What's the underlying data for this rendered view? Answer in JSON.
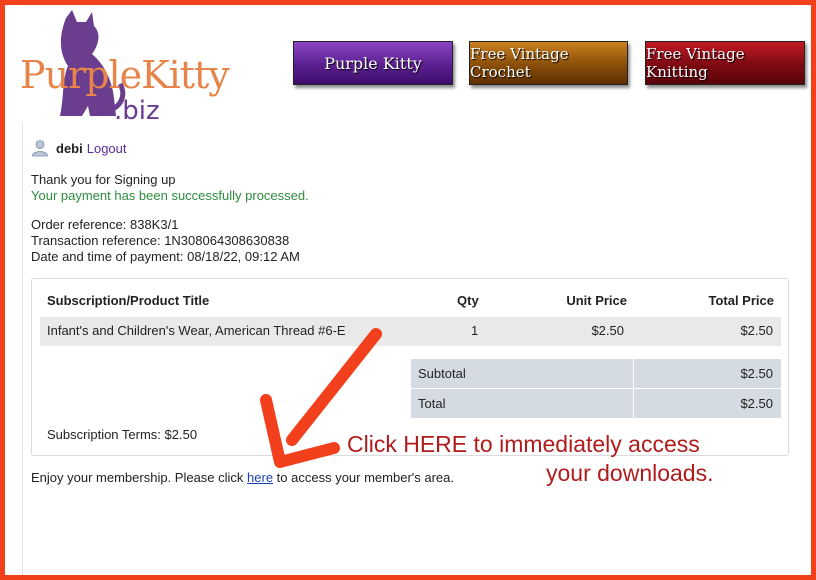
{
  "logo": {
    "purple": "Purple",
    "kitty": "Kitty",
    "tld": ".biz"
  },
  "nav": {
    "purple_kitty": "Purple Kitty",
    "crochet": "Free Vintage Crochet",
    "knitting": "Free Vintage Knitting"
  },
  "user": {
    "name": "debi",
    "logout": "Logout"
  },
  "messages": {
    "thanks": "Thank you for Signing up",
    "success": "Your payment has been successfully processed."
  },
  "order": {
    "order_ref": "Order reference: 838K3/1",
    "transaction_ref": "Transaction reference: 1N308064308630838",
    "datetime": "Date and time of payment: 08/18/22, 09:12 AM"
  },
  "table": {
    "headers": {
      "title": "Subscription/Product Title",
      "qty": "Qty",
      "unit_price": "Unit Price",
      "total_price": "Total Price"
    },
    "rows": [
      {
        "title": "Infant's and Children's Wear, American Thread #6-E",
        "qty": "1",
        "unit_price": "$2.50",
        "total_price": "$2.50"
      }
    ],
    "subtotal_label": "Subtotal",
    "subtotal_value": "$2.50",
    "total_label": "Total",
    "total_value": "$2.50",
    "terms": "Subscription Terms: $2.50"
  },
  "footer": {
    "enjoy_before": "Enjoy your membership. Please click ",
    "link_text": "here",
    "enjoy_after": " to access your member's area."
  },
  "annotation": {
    "line1": "Click HERE to immediately access",
    "line2": "your downloads.",
    "color": "#f3401c"
  },
  "colors": {
    "frame": "#f3401c",
    "success": "#2e8b3d",
    "link": "#1d3fb5",
    "logout": "#5b2b9b"
  }
}
